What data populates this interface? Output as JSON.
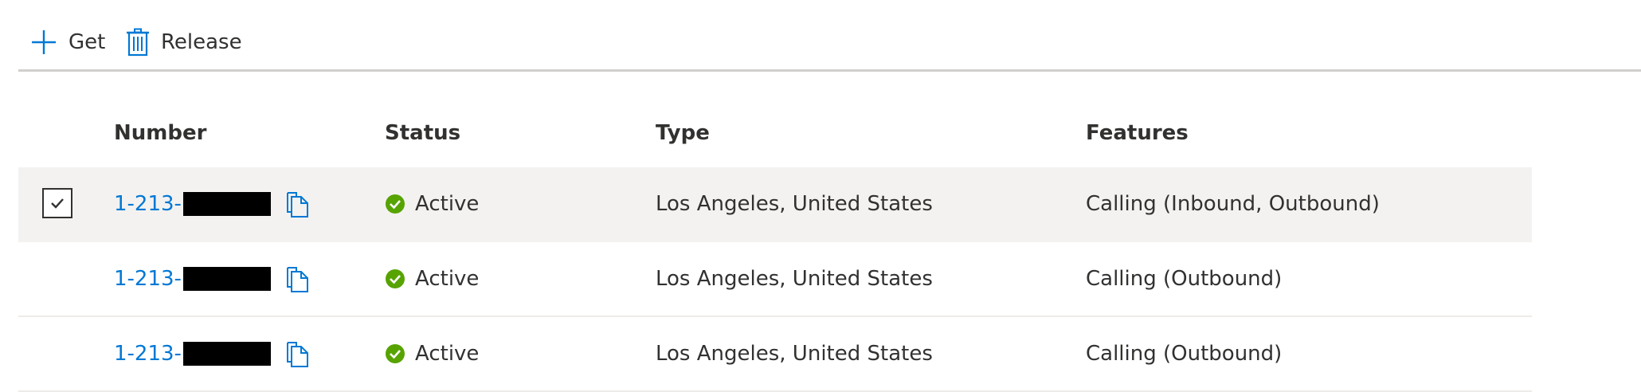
{
  "toolbar": {
    "get_label": "Get",
    "release_label": "Release"
  },
  "table": {
    "headers": {
      "number": "Number",
      "status": "Status",
      "type": "Type",
      "features": "Features"
    },
    "rows": [
      {
        "selected": true,
        "number_prefix": "1-213-",
        "status": "Active",
        "type": "Los Angeles, United States",
        "features": "Calling (Inbound, Outbound)"
      },
      {
        "selected": false,
        "number_prefix": "1-213-",
        "status": "Active",
        "type": "Los Angeles, United States",
        "features": "Calling (Outbound)"
      },
      {
        "selected": false,
        "number_prefix": "1-213-",
        "status": "Active",
        "type": "Los Angeles, United States",
        "features": "Calling (Outbound)"
      }
    ]
  },
  "icons": {
    "get": "plus-icon",
    "release": "trash-icon",
    "copy": "copy-icon",
    "status": "check-circle-icon",
    "checkbox": "checkmark-icon"
  },
  "colors": {
    "accent": "#0078d4",
    "status_active": "#57a300",
    "selected_row": "#f3f2f1",
    "text": "#323130",
    "divider": "#d2d0ce"
  }
}
